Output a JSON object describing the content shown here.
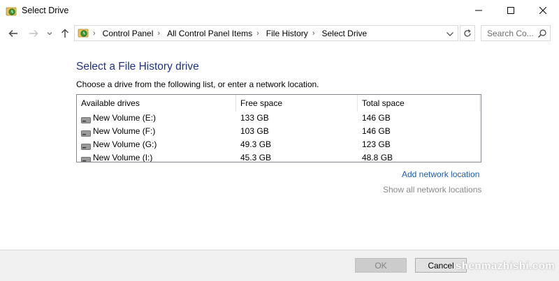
{
  "window": {
    "title": "Select Drive",
    "icon": "file-history-icon"
  },
  "navigation": {
    "breadcrumbs": [
      "Control Panel",
      "All Control Panel Items",
      "File History",
      "Select Drive"
    ],
    "search_placeholder": "Search Co..."
  },
  "main": {
    "heading": "Select a File History drive",
    "instruction": "Choose a drive from the following list, or enter a network location.",
    "table": {
      "columns": [
        "Available drives",
        "Free space",
        "Total space"
      ],
      "rows": [
        {
          "name": "New Volume (E:)",
          "free": "133 GB",
          "total": "146 GB"
        },
        {
          "name": "New Volume (F:)",
          "free": "103 GB",
          "total": "146 GB"
        },
        {
          "name": "New Volume (G:)",
          "free": "49.3 GB",
          "total": "123 GB"
        },
        {
          "name": "New Volume (I:)",
          "free": "45.3 GB",
          "total": "48.8 GB"
        }
      ]
    },
    "add_network_location": "Add network location",
    "show_all_network_locations": "Show all network locations"
  },
  "footer": {
    "ok_label": "OK",
    "cancel_label": "Cancel"
  },
  "watermark": "shenmazhishi.com",
  "colors": {
    "heading": "#1e3287",
    "link": "#1a5da9",
    "disabled_link": "#8a8a8a",
    "footer_bg": "#f0f0f0"
  }
}
